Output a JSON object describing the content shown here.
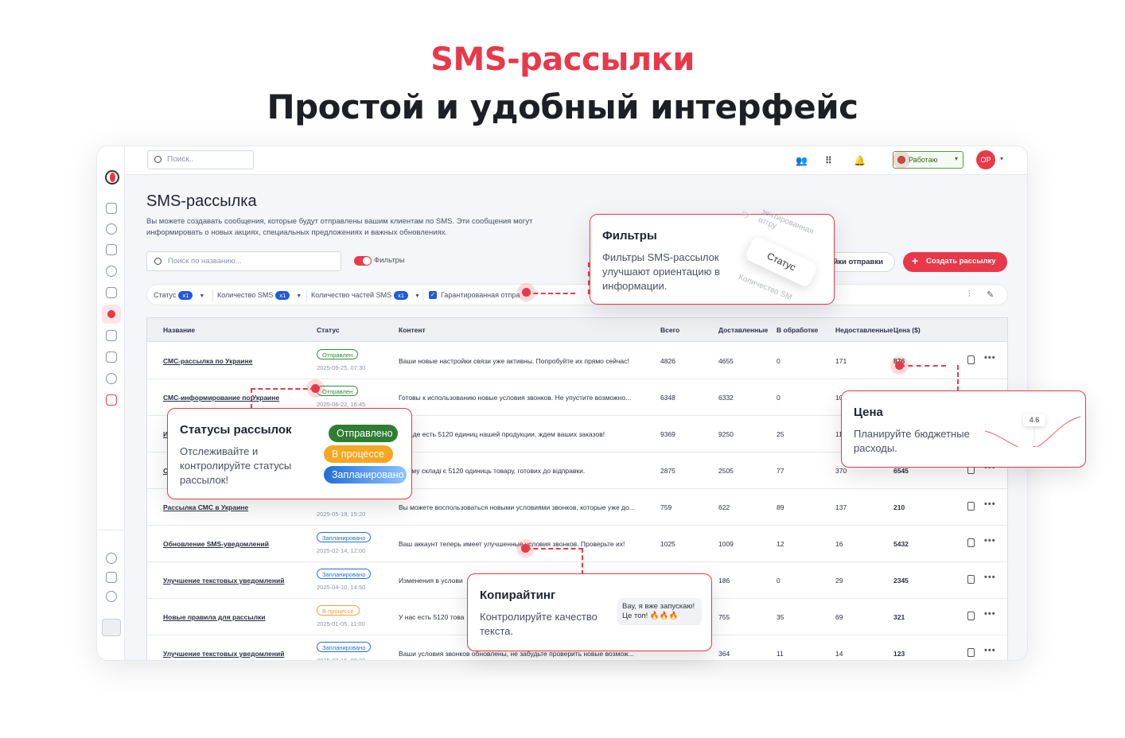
{
  "hero": {
    "title": "SMS-рассылки",
    "subtitle": "Простой и удобный интерфейс"
  },
  "topbar": {
    "search_placeholder": "Поиск..",
    "status": "Работаю",
    "avatar": "OP"
  },
  "page": {
    "title": "SMS-рассылка",
    "description": "Вы можете создавать сообщения, которые будут отправлены вашим клиентам по SMS. Эти сообщения могут информировать о новых акциях, специальных предложениях и важных обновлениях.",
    "name_search_placeholder": "Поиск по названию...",
    "filters_toggle": "Фильтры",
    "settings_button": "йки отправки",
    "create_button": "Создать рассылку"
  },
  "filters": {
    "status": "Статус",
    "status_badge": "x1",
    "sms_count": "Количество SMS",
    "sms_count_badge": "x1",
    "parts_count": "Количество частей SMS",
    "parts_count_badge": "x1",
    "guaranteed": "Гарантированная отпра"
  },
  "table": {
    "headers": {
      "name": "Название",
      "status": "Статус",
      "content": "Контент",
      "total": "Всего",
      "delivered": "Доставленные",
      "processing": "В обработке",
      "undelivered": "Недоставленные",
      "price": "Цена ($)"
    },
    "rows": [
      {
        "name": "СМС-рассылка по Украине",
        "status": "Отправлен",
        "kind": "sent",
        "date": "2025-09-25, 07:30",
        "content": "Ваши новые настройки связи уже активны. Попробуйте их прямо сейчас!",
        "total": "4826",
        "delivered": "4655",
        "processing": "0",
        "undelivered": "171",
        "price": "876"
      },
      {
        "name": "СМС-информирование по Украине",
        "status": "Отправлен",
        "kind": "sent",
        "date": "2025-06-22, 16:45",
        "content": "Готовы к использованию новые условия звонков. Не упустите возможно...",
        "total": "6348",
        "delivered": "6332",
        "processing": "0",
        "undelivered": "10",
        "price": ""
      },
      {
        "name": "И",
        "status": "",
        "kind": "",
        "date": "",
        "content": "складе есть 5120 единиц нашей продукции, ждем ваших заказов!",
        "total": "9369",
        "delivered": "9250",
        "processing": "25",
        "undelivered": "11",
        "price": ""
      },
      {
        "name": "О",
        "status": "",
        "kind": "",
        "date": "",
        "content": "ашому складі є 5120 одиниць товару, готових до відправки.",
        "total": "2875",
        "delivered": "2505",
        "processing": "77",
        "undelivered": "370",
        "price": "6545"
      },
      {
        "name": "Рассылка СМС в Украине",
        "status": "",
        "kind": "",
        "date": "2025-05-19, 15:20",
        "content": "Вы можете воспользоваться новыми условиями звонков, которые уже до...",
        "total": "759",
        "delivered": "622",
        "processing": "89",
        "undelivered": "137",
        "price": "210"
      },
      {
        "name": "Обновление SMS-уведомлений",
        "status": "Запланировано",
        "kind": "plan",
        "date": "2025-02-14, 12:00",
        "content": "Ваш аккаунт теперь имеет улучшенные условия звонков. Проверьте их!",
        "total": "1025",
        "delivered": "1009",
        "processing": "12",
        "undelivered": "16",
        "price": "5432"
      },
      {
        "name": "Улучшение текстовых уведомлений",
        "status": "Запланировано",
        "kind": "plan",
        "date": "2025-04-10, 14:50",
        "content": "Изменения в услови",
        "total": "",
        "delivered": "186",
        "processing": "0",
        "undelivered": "29",
        "price": "2345"
      },
      {
        "name": "Новые правила для рассылки",
        "status": "В процессе",
        "kind": "prog",
        "date": "2025-01-05, 11:00",
        "content": "У нас есть 5120 това",
        "total": "",
        "delivered": "755",
        "processing": "35",
        "undelivered": "69",
        "price": "321"
      },
      {
        "name": "Улучшение текстовых уведомлений",
        "status": "Запланировано",
        "kind": "plan",
        "date": "2025-03-16, 09:30",
        "content": "Ваши условия звонков обновлены, не забудьте проверить новые возмож...",
        "total": "",
        "delivered": "364",
        "processing": "11",
        "undelivered": "14",
        "price": "123"
      }
    ]
  },
  "callouts": {
    "filters": {
      "title": "Фильтры",
      "text": "Фильтры SMS-рассылок улучшают ориентацию в информации.",
      "chip": "Статус",
      "ghost1": "зентированная отгру",
      "ghost2": "Количество SM",
      "ghost3": "ру"
    },
    "statuses": {
      "title": "Статусы рассылок",
      "text": "Отслеживайте и контролируйте статусы рассылок!",
      "pills": [
        "Отправлено",
        "В процессе",
        "Запланировано"
      ]
    },
    "price": {
      "title": "Цена",
      "text": "Планируйте бюджетные расходы.",
      "value": "4.6"
    },
    "copy": {
      "title": "Копирайтинг",
      "text": "Контролируйте качество текста.",
      "bubble": "Вау, я вже запускаю! Це топ! 🔥🔥🔥"
    }
  },
  "colors": {
    "accent": "#e8394a",
    "sent": "#2e8b3a",
    "planned": "#1f6fd6",
    "progress": "#f2a23a"
  }
}
